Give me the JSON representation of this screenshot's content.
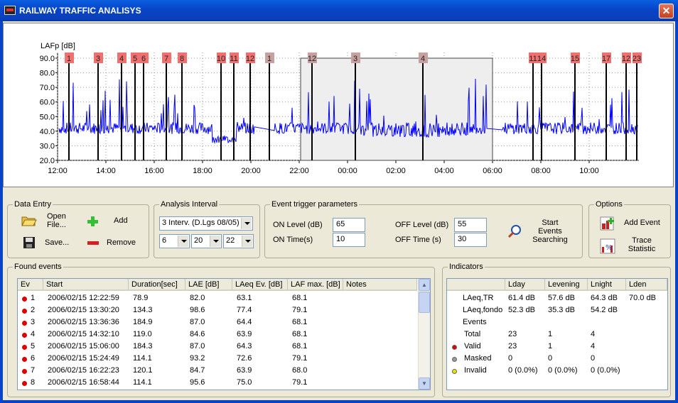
{
  "window": {
    "title": "RAILWAY TRAFFIC ANALISYS",
    "close": "✕"
  },
  "chart": {
    "ylabel": "LAFp [dB]",
    "yticks": [
      "90.0",
      "80.0",
      "70.0",
      "60.0",
      "50.0",
      "40.0",
      "30.0",
      "20.0"
    ],
    "xticks": [
      "12:00",
      "14:00",
      "16:00",
      "18:00",
      "20:00",
      "22:00",
      "00:00",
      "02:00",
      "04:00",
      "06:00",
      "08:00",
      "10:00"
    ],
    "event_marker_labels": [
      "1",
      "3",
      "4",
      "5",
      "6",
      "7",
      "8",
      "10",
      "11",
      "12",
      "1",
      "12",
      "3",
      "4",
      "11",
      "14",
      "15",
      "17",
      "12",
      "23"
    ]
  },
  "data_entry": {
    "legend": "Data Entry",
    "open": "Open\nFile...",
    "add": "Add",
    "save": "Save...",
    "remove": "Remove"
  },
  "analysis_interval": {
    "legend": "Analysis Interval",
    "mode": "3 Interv. (D.Lgs 08/05)",
    "h1": "6",
    "h2": "20",
    "h3": "22"
  },
  "event_trigger": {
    "legend": "Event trigger parameters",
    "on_level_label": "ON Level (dB)",
    "on_level": "65",
    "on_time_label": "ON Time(s)",
    "on_time": "10",
    "off_level_label": "OFF Level (dB)",
    "off_level": "55",
    "off_time_label": "OFF Time (s)",
    "off_time": "30",
    "start_search": "Start\nEvents\nSearching"
  },
  "options": {
    "legend": "Options",
    "add_event": "Add Event",
    "trace_statistic": "Trace\nStatistic"
  },
  "found_events": {
    "legend": "Found events",
    "columns": [
      "Ev",
      "Start",
      "Duration[sec]",
      "LAE [dB]",
      "LAeq Ev. [dB]",
      "LAF max. [dB]",
      "Notes"
    ],
    "rows": [
      [
        "1",
        "2006/02/15 12:22:59",
        "78.9",
        "82.0",
        "63.1",
        "68.1"
      ],
      [
        "2",
        "2006/02/15 13:30:20",
        "134.3",
        "98.6",
        "77.4",
        "79.1"
      ],
      [
        "3",
        "2006/02/15 13:36:36",
        "184.9",
        "87.0",
        "64.4",
        "68.1"
      ],
      [
        "4",
        "2006/02/15 14:32:10",
        "119.0",
        "84.6",
        "63.9",
        "68.1"
      ],
      [
        "5",
        "2006/02/15 15:06:00",
        "184.3",
        "87.0",
        "64.3",
        "68.1"
      ],
      [
        "6",
        "2006/02/15 15:24:49",
        "114.1",
        "93.2",
        "72.6",
        "79.1"
      ],
      [
        "7",
        "2006/02/15 16:22:23",
        "120.1",
        "84.7",
        "63.9",
        "68.0"
      ],
      [
        "8",
        "2006/02/15 16:58:44",
        "114.1",
        "95.6",
        "75.0",
        "79.1"
      ]
    ]
  },
  "indicators": {
    "legend": "Indicators",
    "columns": [
      "Lday",
      "Levening",
      "Lnight",
      "Lden"
    ],
    "laeq_tr": {
      "label": "LAeq,TR",
      "values": [
        "61.4 dB",
        "57.6 dB",
        "64.3 dB",
        "70.0 dB"
      ]
    },
    "laeq_fondo": {
      "label": "LAeq,fondo",
      "values": [
        "52.3 dB",
        "35.3 dB",
        "54.2 dB"
      ]
    },
    "events_label": "Events",
    "total": {
      "label": "Total",
      "values": [
        "23",
        "1",
        "4"
      ]
    },
    "valid": {
      "label": "Valid",
      "values": [
        "23",
        "1",
        "4"
      ]
    },
    "masked": {
      "label": "Masked",
      "values": [
        "0",
        "0",
        "0"
      ]
    },
    "invalid": {
      "label": "Invalid",
      "values": [
        "0 (0.0%)",
        "0 (0.0%)",
        "0 (0.0%)"
      ]
    }
  },
  "colors": {
    "signal": "#0000ff",
    "marker_red": "#f07070",
    "marker_grey": "#c8a0a0",
    "valid": "#dd0000",
    "masked": "#999999",
    "invalid": "#f0e000"
  }
}
